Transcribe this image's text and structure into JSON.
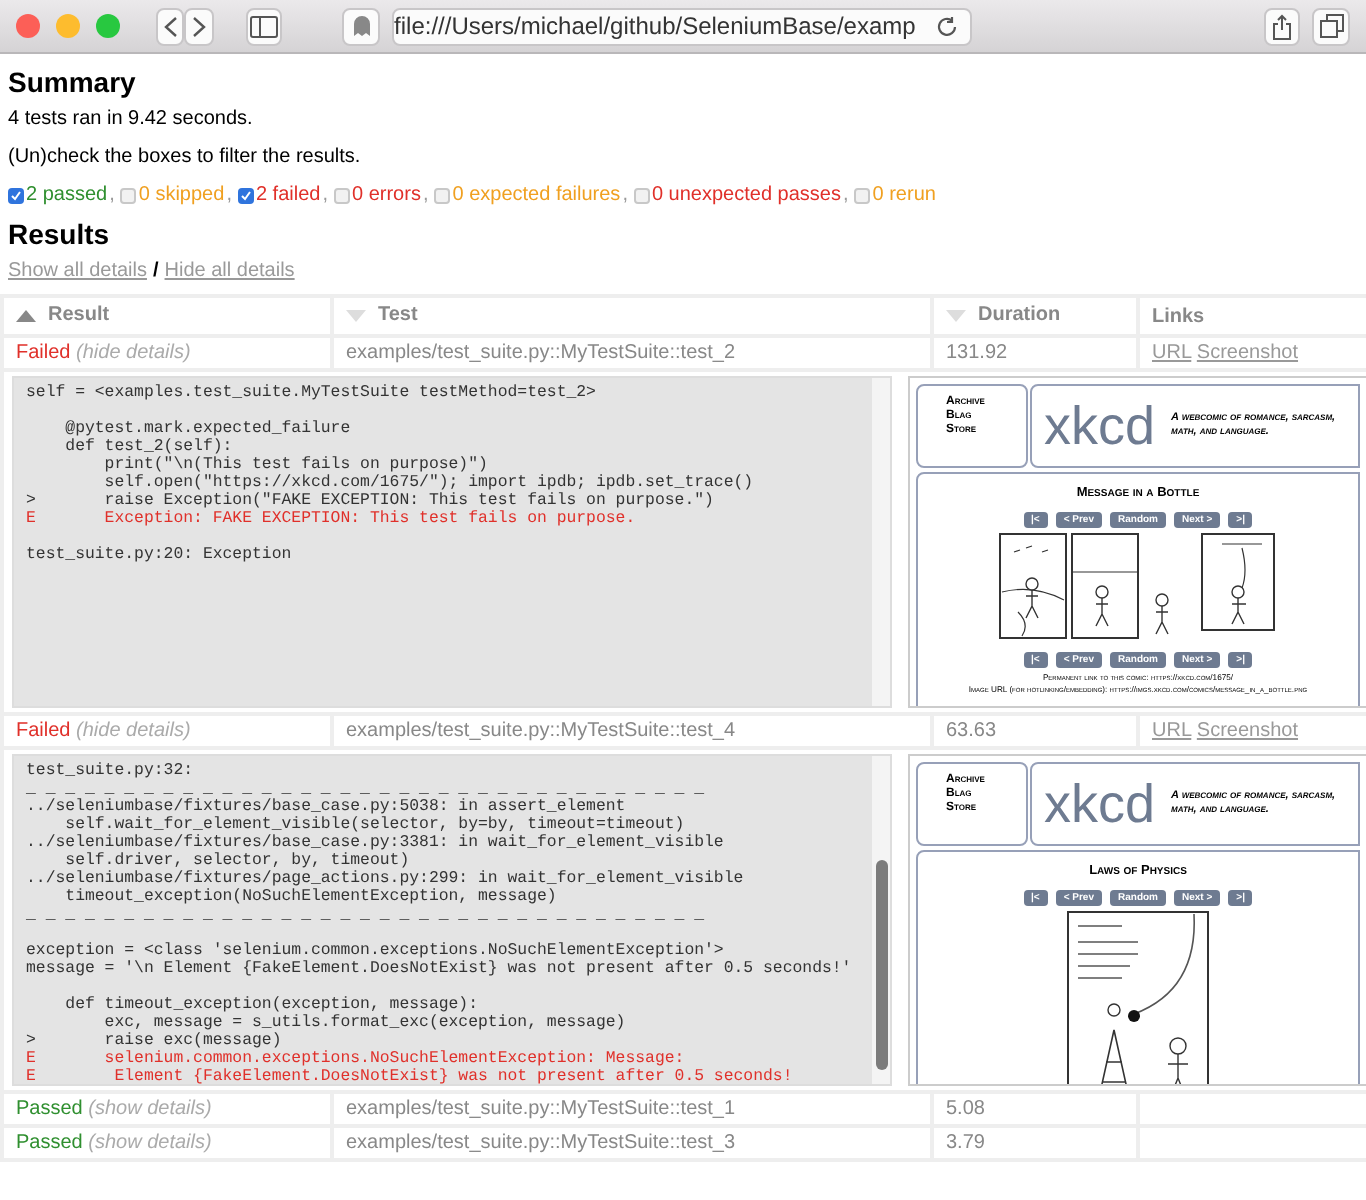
{
  "browser": {
    "url": "file:///Users/michael/github/SeleniumBase/examp"
  },
  "summary": {
    "title": "Summary",
    "run_info": "4 tests ran in 9.42 seconds.",
    "hint": "(Un)check the boxes to filter the results."
  },
  "filters": [
    {
      "label": "2 passed",
      "checked": true,
      "color": "#2f8f2f",
      "suffix": ","
    },
    {
      "label": "0 skipped",
      "checked": false,
      "color": "#f0a020",
      "suffix": ","
    },
    {
      "label": "2 failed",
      "checked": true,
      "color": "#e0302a",
      "suffix": ","
    },
    {
      "label": "0 errors",
      "checked": false,
      "color": "#e0302a",
      "suffix": ","
    },
    {
      "label": "0 expected failures",
      "checked": false,
      "color": "#f0a020",
      "suffix": ","
    },
    {
      "label": "0 unexpected passes",
      "checked": false,
      "color": "#e0302a",
      "suffix": ","
    },
    {
      "label": "0 rerun",
      "checked": false,
      "color": "#f0a020"
    }
  ],
  "results": {
    "title": "Results",
    "show_all": "Show all details",
    "divider": "/",
    "hide_all": "Hide all details"
  },
  "table": {
    "columns": [
      {
        "label": "Result",
        "sorted": true
      },
      {
        "label": "Test",
        "sorted": false
      },
      {
        "label": "Duration",
        "sorted": false
      },
      {
        "label": "Links"
      }
    ],
    "rows": [
      {
        "color": "#e0302a",
        "result": "Failed",
        "toggle": "(hide details)",
        "test": "examples/test_suite.py::MyTestSuite::test_2",
        "duration": "131.92",
        "links": [
          "URL",
          "Screenshot"
        ],
        "expanded": true,
        "log": [
          {
            "kind": "code",
            "text": "self = <examples.test_suite.MyTestSuite testMethod=test_2>"
          },
          {
            "kind": "blank"
          },
          {
            "kind": "code",
            "text": "    @pytest.mark.expected_failure"
          },
          {
            "kind": "code",
            "text": "    def test_2(self):"
          },
          {
            "kind": "code",
            "text": "        print(\"\\n(This test fails on purpose)\")"
          },
          {
            "kind": "code",
            "text": "        self.open(\"https://xkcd.com/1675/\"); import ipdb; ipdb.set_trace()"
          },
          {
            "kind": "code",
            "text": ">       raise Exception(\"FAKE EXCEPTION: This test fails on purpose.\")"
          },
          {
            "kind": "error",
            "text": "E       Exception: FAKE EXCEPTION: This test fails on purpose."
          },
          {
            "kind": "blank"
          },
          {
            "kind": "code",
            "text": "test_suite.py:20: Exception"
          }
        ],
        "screenshot": {
          "nav": [
            "Archive",
            "Blag",
            "Store"
          ],
          "logo": "xkcd",
          "tagline": "A webcomic of romance, sarcasm, math, and language.",
          "comic_title": "Message in a Bottle",
          "kind": "beach",
          "buttons": [
            "|<",
            "< Prev",
            "Random",
            "Next >",
            ">|"
          ],
          "bottom_buttons": [
            "|<",
            "< Prev",
            "Random",
            "Next >",
            ">|"
          ],
          "footer": [
            "Permanent link to this comic: https://xkcd.com/1675/",
            "Image URL (for hotlinking/embedding): https://imgs.xkcd.com/comics/message_in_a_bottle.png"
          ]
        }
      },
      {
        "color": "#e0302a",
        "result": "Failed",
        "toggle": "(hide details)",
        "test": "examples/test_suite.py::MyTestSuite::test_4",
        "duration": "63.63",
        "links": [
          "URL",
          "Screenshot"
        ],
        "expanded": true,
        "log": [
          {
            "kind": "code",
            "text": "test_suite.py:32:"
          },
          {
            "kind": "code",
            "text": "_ _ _ _ _ _ _ _ _ _ _ _ _ _ _ _ _ _ _ _ _ _ _ _ _ _ _ _ _ _ _ _ _ _ _"
          },
          {
            "kind": "code",
            "text": "../seleniumbase/fixtures/base_case.py:5038: in assert_element"
          },
          {
            "kind": "code",
            "text": "    self.wait_for_element_visible(selector, by=by, timeout=timeout)"
          },
          {
            "kind": "code",
            "text": "../seleniumbase/fixtures/base_case.py:3381: in wait_for_element_visible"
          },
          {
            "kind": "code",
            "text": "    self.driver, selector, by, timeout)"
          },
          {
            "kind": "code",
            "text": "../seleniumbase/fixtures/page_actions.py:299: in wait_for_element_visible"
          },
          {
            "kind": "code",
            "text": "    timeout_exception(NoSuchElementException, message)"
          },
          {
            "kind": "code",
            "text": "_ _ _ _ _ _ _ _ _ _ _ _ _ _ _ _ _ _ _ _ _ _ _ _ _ _ _ _ _ _ _ _ _ _ _"
          },
          {
            "kind": "blank"
          },
          {
            "kind": "code",
            "text": "exception = <class 'selenium.common.exceptions.NoSuchElementException'>"
          },
          {
            "kind": "code",
            "text": "message = '\\n Element {FakeElement.DoesNotExist} was not present after 0.5 seconds!'"
          },
          {
            "kind": "blank"
          },
          {
            "kind": "code",
            "text": "    def timeout_exception(exception, message):"
          },
          {
            "kind": "code",
            "text": "        exc, message = s_utils.format_exc(exception, message)"
          },
          {
            "kind": "code",
            "text": ">       raise exc(message)"
          },
          {
            "kind": "error",
            "text": "E       selenium.common.exceptions.NoSuchElementException: Message:"
          },
          {
            "kind": "error",
            "text": "E        Element {FakeElement.DoesNotExist} was not present after 0.5 seconds!"
          }
        ],
        "screenshot": {
          "nav": [
            "Archive",
            "Blag",
            "Store"
          ],
          "logo": "xkcd",
          "tagline": "A webcomic of romance, sarcasm, math, and language.",
          "comic_title": "Laws of Physics",
          "kind": "ladder",
          "buttons": [
            "|<",
            "< Prev",
            "Random",
            "Next >",
            ">|"
          ]
        }
      },
      {
        "color": "#2f8f2f",
        "result": "Passed",
        "toggle": "(show details)",
        "test": "examples/test_suite.py::MyTestSuite::test_1",
        "duration": "5.08",
        "expanded": false
      },
      {
        "color": "#2f8f2f",
        "result": "Passed",
        "toggle": "(show details)",
        "test": "examples/test_suite.py::MyTestSuite::test_3",
        "duration": "3.79",
        "expanded": false
      }
    ]
  }
}
